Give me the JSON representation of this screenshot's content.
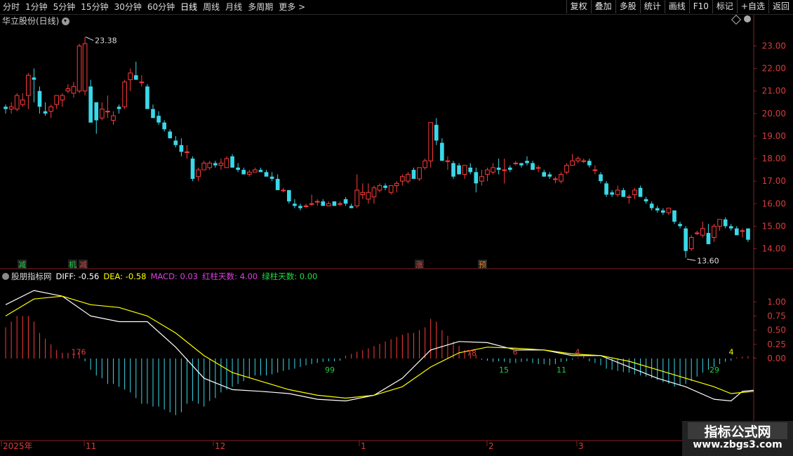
{
  "toolbar": {
    "periods": [
      "分时",
      "1分钟",
      "5分钟",
      "15分钟",
      "30分钟",
      "60分钟",
      "日线",
      "周线",
      "月线",
      "多周期",
      "更多 >"
    ],
    "active_period": "日线",
    "actions": [
      "复权",
      "叠加",
      "多股",
      "统计",
      "画线",
      "F10",
      "标记",
      "+自选",
      "返回"
    ]
  },
  "stock": {
    "title": "华立股份(日线)"
  },
  "annotations": {
    "high_label": "23.38",
    "low_label": "13.60",
    "signals": [
      {
        "text": "减",
        "color": "#22cc44"
      },
      {
        "text": "机",
        "color": "#22cc44"
      },
      {
        "text": "减",
        "color": "#e04040"
      },
      {
        "text": "涨",
        "color": "#e04040"
      },
      {
        "text": "预",
        "color": "#e08020"
      }
    ]
  },
  "indicator": {
    "name": "股朋指标网",
    "diff_label": "DIFF: -0.56",
    "dea_label": "DEA: -0.58",
    "macd_label": "MACD: 0.03",
    "red_days_label": "红柱天数: 4.00",
    "green_days_label": "绿柱天数: 0.00",
    "bar_counts": [
      {
        "text": "176",
        "color": "#e04040"
      },
      {
        "text": "99",
        "color": "#22cc44"
      },
      {
        "text": "78",
        "color": "#e04040"
      },
      {
        "text": "15",
        "color": "#22cc44"
      },
      {
        "text": "6",
        "color": "#e04040"
      },
      {
        "text": "11",
        "color": "#22cc44"
      },
      {
        "text": "4",
        "color": "#e04040"
      },
      {
        "text": "29",
        "color": "#22cc44"
      },
      {
        "text": "4",
        "color": "#ffff00"
      }
    ]
  },
  "colors": {
    "up": "#ff3b3b",
    "down": "#3ad8e8",
    "diff": "#ffffff",
    "dea": "#ffff00",
    "grid": "#8a1f1f",
    "axis_text": "#d83c3c"
  },
  "chart_data": [
    {
      "type": "candlestick",
      "ylim": [
        13.3,
        23.7
      ],
      "y_ticks": [
        "23.00",
        "22.00",
        "21.00",
        "20.00",
        "19.00",
        "18.00",
        "17.00",
        "16.00",
        "15.00",
        "14.00"
      ],
      "x_ticks": [
        "2025年",
        "11",
        "12",
        "1",
        "2",
        "3"
      ],
      "bars": [
        [
          20.3,
          20.4,
          20.0,
          20.2
        ],
        [
          20.2,
          20.5,
          20.0,
          20.3
        ],
        [
          20.2,
          20.9,
          20.1,
          20.8
        ],
        [
          20.4,
          20.9,
          20.3,
          20.6
        ],
        [
          20.8,
          21.8,
          20.2,
          21.7
        ],
        [
          21.6,
          22.0,
          20.5,
          21.5
        ],
        [
          21.0,
          21.2,
          20.0,
          20.3
        ],
        [
          20.1,
          20.5,
          19.9,
          20.0
        ],
        [
          20.1,
          20.4,
          19.8,
          20.3
        ],
        [
          20.4,
          20.8,
          20.2,
          20.8
        ],
        [
          20.6,
          20.9,
          20.3,
          20.8
        ],
        [
          21.0,
          21.3,
          20.9,
          21.1
        ],
        [
          20.9,
          21.4,
          20.7,
          21.2
        ],
        [
          21.0,
          23.1,
          20.9,
          23.0
        ],
        [
          21.0,
          23.4,
          20.8,
          23.1
        ],
        [
          21.2,
          21.5,
          19.6,
          19.6
        ],
        [
          20.5,
          20.5,
          19.1,
          19.7
        ],
        [
          19.8,
          20.5,
          19.7,
          20.2
        ],
        [
          20.1,
          20.8,
          19.8,
          20.1
        ],
        [
          19.7,
          20.1,
          19.5,
          19.9
        ],
        [
          20.3,
          20.4,
          20.0,
          20.2
        ],
        [
          20.3,
          21.5,
          20.2,
          21.4
        ],
        [
          21.5,
          22.0,
          21.0,
          21.8
        ],
        [
          21.7,
          22.3,
          21.5,
          21.5
        ],
        [
          21.4,
          21.7,
          21.2,
          21.4
        ],
        [
          21.2,
          21.3,
          20.3,
          20.2
        ],
        [
          20.2,
          20.4,
          19.8,
          19.8
        ],
        [
          19.9,
          20.1,
          19.5,
          19.6
        ],
        [
          19.6,
          19.7,
          19.2,
          19.3
        ],
        [
          19.2,
          19.3,
          18.9,
          18.9
        ],
        [
          18.8,
          19.0,
          18.5,
          18.6
        ],
        [
          18.6,
          18.9,
          18.1,
          18.3
        ],
        [
          18.3,
          18.6,
          18.0,
          18.3
        ],
        [
          18.0,
          18.1,
          17.0,
          17.1
        ],
        [
          17.2,
          17.6,
          17.0,
          17.5
        ],
        [
          17.5,
          17.9,
          17.5,
          17.8
        ],
        [
          17.6,
          17.9,
          17.5,
          17.8
        ],
        [
          17.8,
          17.9,
          17.6,
          17.7
        ],
        [
          17.7,
          18.0,
          17.5,
          17.8
        ],
        [
          17.6,
          18.1,
          17.6,
          18.0
        ],
        [
          18.1,
          18.2,
          17.6,
          17.6
        ],
        [
          17.6,
          17.8,
          17.4,
          17.5
        ],
        [
          17.5,
          17.6,
          17.3,
          17.3
        ],
        [
          17.3,
          17.5,
          17.2,
          17.4
        ],
        [
          17.4,
          17.6,
          17.4,
          17.5
        ],
        [
          17.5,
          17.6,
          17.4,
          17.4
        ],
        [
          17.4,
          17.5,
          17.2,
          17.2
        ],
        [
          17.2,
          17.4,
          17.0,
          17.1
        ],
        [
          17.1,
          17.3,
          16.6,
          16.6
        ],
        [
          16.6,
          16.7,
          16.5,
          16.6
        ],
        [
          16.6,
          16.6,
          16.0,
          16.1
        ],
        [
          16.0,
          16.2,
          15.8,
          15.9
        ],
        [
          15.9,
          16.0,
          15.7,
          15.8
        ],
        [
          15.9,
          16.0,
          15.8,
          15.9
        ],
        [
          16.0,
          16.4,
          15.9,
          16.0
        ],
        [
          16.1,
          16.2,
          15.9,
          16.1
        ],
        [
          16.1,
          16.2,
          15.9,
          15.9
        ],
        [
          15.9,
          16.1,
          15.9,
          16.0
        ],
        [
          16.1,
          16.1,
          15.9,
          15.9
        ],
        [
          16.0,
          16.1,
          15.9,
          16.0
        ],
        [
          16.2,
          16.3,
          15.9,
          16.0
        ],
        [
          15.9,
          16.0,
          15.8,
          15.8
        ],
        [
          15.9,
          17.3,
          15.8,
          16.6
        ],
        [
          16.4,
          16.9,
          16.2,
          16.5
        ],
        [
          16.2,
          16.9,
          16.0,
          16.5
        ],
        [
          16.3,
          16.8,
          16.0,
          16.7
        ],
        [
          16.6,
          16.9,
          16.5,
          16.8
        ],
        [
          16.8,
          16.9,
          16.6,
          16.7
        ],
        [
          16.5,
          16.8,
          16.4,
          16.8
        ],
        [
          16.8,
          17.0,
          16.5,
          16.9
        ],
        [
          17.0,
          17.3,
          16.8,
          17.2
        ],
        [
          17.0,
          17.4,
          16.9,
          17.3
        ],
        [
          17.5,
          17.6,
          17.1,
          17.1
        ],
        [
          17.1,
          17.6,
          17.0,
          17.6
        ],
        [
          17.6,
          18.0,
          17.5,
          17.9
        ],
        [
          17.9,
          19.6,
          17.6,
          19.6
        ],
        [
          19.5,
          19.8,
          18.6,
          18.8
        ],
        [
          18.7,
          18.9,
          17.9,
          17.9
        ],
        [
          17.9,
          18.1,
          17.5,
          17.9
        ],
        [
          17.8,
          17.9,
          17.1,
          17.2
        ],
        [
          17.7,
          17.8,
          17.3,
          17.3
        ],
        [
          17.3,
          17.7,
          17.1,
          17.7
        ],
        [
          17.6,
          17.8,
          17.3,
          17.4
        ],
        [
          17.4,
          17.6,
          16.5,
          16.9
        ],
        [
          17.0,
          17.5,
          16.8,
          17.2
        ],
        [
          17.3,
          17.6,
          17.0,
          17.5
        ],
        [
          17.4,
          17.8,
          17.3,
          17.6
        ],
        [
          17.6,
          18.0,
          17.3,
          17.5
        ],
        [
          17.5,
          18.0,
          16.9,
          17.5
        ],
        [
          17.6,
          17.7,
          17.4,
          17.5
        ],
        [
          17.8,
          17.9,
          17.7,
          17.8
        ],
        [
          17.8,
          17.8,
          17.6,
          17.7
        ],
        [
          17.9,
          18.1,
          17.7,
          17.8
        ],
        [
          17.8,
          17.9,
          17.5,
          17.5
        ],
        [
          17.6,
          17.7,
          17.4,
          17.6
        ],
        [
          17.4,
          17.5,
          17.2,
          17.2
        ],
        [
          17.3,
          17.4,
          17.1,
          17.2
        ],
        [
          17.1,
          17.2,
          16.9,
          17.1
        ],
        [
          17.0,
          17.4,
          16.9,
          17.3
        ],
        [
          17.4,
          17.8,
          17.3,
          17.7
        ],
        [
          17.7,
          18.2,
          17.7,
          17.9
        ],
        [
          17.9,
          18.1,
          17.8,
          18.0
        ],
        [
          17.9,
          18.0,
          17.8,
          17.9
        ],
        [
          17.9,
          18.0,
          17.6,
          17.7
        ],
        [
          17.5,
          17.7,
          17.3,
          17.5
        ],
        [
          17.3,
          17.4,
          16.9,
          17.0
        ],
        [
          16.9,
          17.0,
          16.3,
          16.4
        ],
        [
          16.5,
          16.6,
          16.3,
          16.4
        ],
        [
          16.4,
          16.8,
          16.3,
          16.6
        ],
        [
          16.6,
          16.7,
          16.3,
          16.3
        ],
        [
          16.3,
          16.4,
          16.0,
          16.3
        ],
        [
          16.4,
          16.7,
          16.2,
          16.6
        ],
        [
          16.7,
          16.8,
          16.3,
          16.3
        ],
        [
          16.2,
          16.3,
          16.0,
          16.1
        ],
        [
          16.0,
          16.1,
          15.7,
          15.8
        ],
        [
          15.8,
          15.9,
          15.6,
          15.7
        ],
        [
          15.7,
          15.8,
          15.5,
          15.6
        ],
        [
          15.6,
          15.8,
          15.5,
          15.8
        ],
        [
          15.7,
          15.7,
          15.1,
          15.2
        ],
        [
          15.1,
          15.2,
          14.9,
          15.0
        ],
        [
          14.9,
          15.0,
          13.6,
          13.9
        ],
        [
          14.0,
          14.6,
          13.9,
          14.5
        ],
        [
          14.7,
          14.8,
          14.6,
          14.7
        ],
        [
          14.6,
          15.2,
          14.5,
          14.9
        ],
        [
          14.7,
          15.1,
          14.2,
          14.2
        ],
        [
          14.5,
          15.1,
          14.3,
          15.0
        ],
        [
          15.0,
          15.3,
          14.8,
          15.3
        ],
        [
          15.3,
          15.4,
          14.9,
          15.0
        ],
        [
          15.0,
          15.1,
          14.8,
          14.9
        ],
        [
          14.9,
          15.0,
          14.6,
          14.6
        ],
        [
          14.8,
          14.9,
          14.5,
          14.8
        ],
        [
          14.9,
          14.9,
          14.3,
          14.4
        ]
      ]
    },
    {
      "type": "macd",
      "ylim": [
        -1.45,
        1.35
      ],
      "y_ticks": [
        "1.00",
        "0.75",
        "0.50",
        "0.25",
        "0.00"
      ],
      "series": [
        {
          "name": "DIFF",
          "x": [
            0,
            5,
            10,
            15,
            20,
            25,
            30,
            35,
            40,
            45,
            50,
            55,
            60,
            65,
            70,
            75,
            80,
            85,
            90,
            95,
            100,
            105,
            110,
            115,
            120,
            125,
            128,
            130,
            132
          ],
          "values": [
            0.95,
            1.2,
            1.1,
            0.75,
            0.65,
            0.65,
            0.2,
            -0.35,
            -0.55,
            -0.58,
            -0.62,
            -0.72,
            -0.75,
            -0.65,
            -0.35,
            0.15,
            0.3,
            0.28,
            0.15,
            0.15,
            0.05,
            0.05,
            -0.15,
            -0.35,
            -0.5,
            -0.72,
            -0.75,
            -0.58,
            -0.56
          ]
        },
        {
          "name": "DEA",
          "x": [
            0,
            5,
            10,
            15,
            20,
            25,
            30,
            35,
            40,
            45,
            50,
            55,
            60,
            65,
            70,
            75,
            80,
            85,
            90,
            95,
            100,
            105,
            110,
            115,
            120,
            125,
            128,
            130,
            132
          ],
          "values": [
            0.75,
            1.05,
            1.1,
            0.95,
            0.9,
            0.75,
            0.45,
            0.05,
            -0.25,
            -0.4,
            -0.55,
            -0.65,
            -0.7,
            -0.65,
            -0.5,
            -0.15,
            0.1,
            0.2,
            0.18,
            0.15,
            0.08,
            0.05,
            -0.05,
            -0.2,
            -0.35,
            -0.5,
            -0.62,
            -0.6,
            -0.58
          ]
        }
      ],
      "histogram": [
        0.55,
        0.65,
        0.75,
        0.75,
        0.75,
        0.65,
        0.45,
        0.35,
        0.25,
        0.15,
        0.1,
        0.1,
        0.08,
        0.1,
        -0.05,
        -0.2,
        -0.3,
        -0.35,
        -0.45,
        -0.45,
        -0.5,
        -0.55,
        -0.6,
        -0.7,
        -0.8,
        -0.8,
        -0.85,
        -0.85,
        -0.9,
        -0.95,
        -1.0,
        -0.95,
        -0.8,
        -0.75,
        -0.8,
        -0.85,
        -0.75,
        -0.7,
        -0.6,
        -0.55,
        -0.5,
        -0.45,
        -0.4,
        -0.35,
        -0.3,
        -0.3,
        -0.3,
        -0.28,
        -0.25,
        -0.22,
        -0.2,
        -0.18,
        -0.15,
        -0.12,
        -0.1,
        -0.08,
        -0.06,
        -0.05,
        -0.05,
        -0.04,
        0.05,
        0.08,
        0.12,
        0.15,
        0.18,
        0.22,
        0.26,
        0.3,
        0.34,
        0.38,
        0.42,
        0.45,
        0.45,
        0.5,
        0.55,
        0.7,
        0.65,
        0.5,
        0.4,
        0.3,
        0.22,
        0.15,
        0.1,
        0.06,
        -0.02,
        -0.04,
        -0.06,
        -0.05,
        -0.06,
        -0.08,
        -0.08,
        -0.06,
        -0.05,
        -0.08,
        -0.1,
        -0.1,
        -0.12,
        -0.1,
        -0.06,
        -0.05,
        -0.02,
        0.02,
        0.04,
        -0.05,
        -0.08,
        -0.12,
        -0.18,
        -0.2,
        -0.22,
        -0.24,
        -0.25,
        -0.28,
        -0.3,
        -0.32,
        -0.35,
        -0.38,
        -0.42,
        -0.45,
        -0.5,
        -0.48,
        -0.45,
        -0.4,
        -0.32,
        -0.25,
        -0.2,
        -0.15,
        -0.1,
        -0.06,
        -0.04,
        0.02,
        0.03,
        0.04,
        0.03
      ]
    }
  ]
}
